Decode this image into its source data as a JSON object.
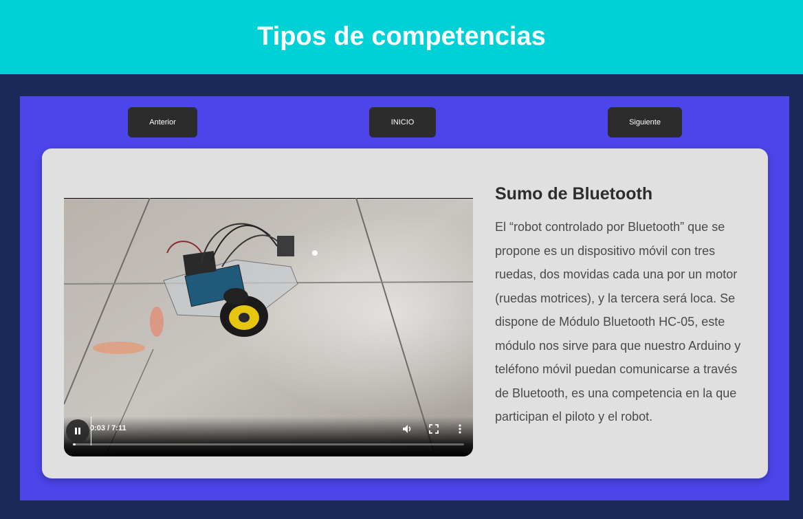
{
  "header": {
    "title": "Tipos de competencias"
  },
  "nav": {
    "prev_label": "Anterior",
    "home_label": "INICIO",
    "next_label": "Siguiente"
  },
  "card": {
    "heading": "Sumo de Bluetooth",
    "description": "El “robot controlado por Bluetooth” que se propone es un dispositivo móvil con tres ruedas, dos movidas cada una por un motor (ruedas motrices), y la tercera será loca. Se dispone de Módulo Bluetooth HC-05, este módulo nos sirve para que nuestro Arduino y teléfono móvil puedan comunicarse a través de Bluetooth, es una competencia en la que participan el piloto y el robot."
  },
  "video": {
    "time_display": "0:03 / 7:11",
    "progress_fraction": 0.007,
    "icons": [
      "pause-icon",
      "volume-icon",
      "fullscreen-icon",
      "more-options-icon"
    ]
  },
  "colors": {
    "header_bg": "#00d1d6",
    "page_bg": "#192a5a",
    "panel_bg": "#4c45ea",
    "card_bg": "#e0e0e0",
    "button_bg": "#2c2c2c"
  }
}
